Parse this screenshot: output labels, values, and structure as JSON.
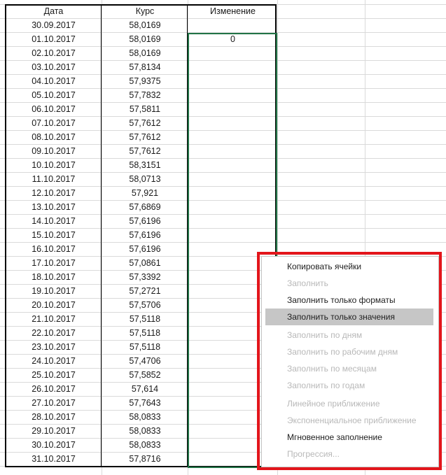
{
  "table": {
    "headers": [
      "Дата",
      "Курс",
      "Изменение"
    ],
    "rows": [
      [
        "30.09.2017",
        "58,0169",
        ""
      ],
      [
        "01.10.2017",
        "58,0169",
        "0"
      ],
      [
        "02.10.2017",
        "58,0169",
        ""
      ],
      [
        "03.10.2017",
        "57,8134",
        ""
      ],
      [
        "04.10.2017",
        "57,9375",
        ""
      ],
      [
        "05.10.2017",
        "57,7832",
        ""
      ],
      [
        "06.10.2017",
        "57,5811",
        ""
      ],
      [
        "07.10.2017",
        "57,7612",
        ""
      ],
      [
        "08.10.2017",
        "57,7612",
        ""
      ],
      [
        "09.10.2017",
        "57,7612",
        ""
      ],
      [
        "10.10.2017",
        "58,3151",
        ""
      ],
      [
        "11.10.2017",
        "58,0713",
        ""
      ],
      [
        "12.10.2017",
        "57,921",
        ""
      ],
      [
        "13.10.2017",
        "57,6869",
        ""
      ],
      [
        "14.10.2017",
        "57,6196",
        ""
      ],
      [
        "15.10.2017",
        "57,6196",
        ""
      ],
      [
        "16.10.2017",
        "57,6196",
        ""
      ],
      [
        "17.10.2017",
        "57,0861",
        ""
      ],
      [
        "18.10.2017",
        "57,3392",
        ""
      ],
      [
        "19.10.2017",
        "57,2721",
        ""
      ],
      [
        "20.10.2017",
        "57,5706",
        ""
      ],
      [
        "21.10.2017",
        "57,5118",
        ""
      ],
      [
        "22.10.2017",
        "57,5118",
        ""
      ],
      [
        "23.10.2017",
        "57,5118",
        ""
      ],
      [
        "24.10.2017",
        "57,4706",
        ""
      ],
      [
        "25.10.2017",
        "57,5852",
        ""
      ],
      [
        "26.10.2017",
        "57,614",
        ""
      ],
      [
        "27.10.2017",
        "57,7643",
        ""
      ],
      [
        "28.10.2017",
        "58,0833",
        ""
      ],
      [
        "29.10.2017",
        "58,0833",
        ""
      ],
      [
        "30.10.2017",
        "58,0833",
        ""
      ],
      [
        "31.10.2017",
        "57,8716",
        ""
      ]
    ]
  },
  "context_menu": {
    "items": [
      {
        "label": "Копировать ячейки",
        "enabled": true,
        "highlighted": false
      },
      {
        "label": "Заполнить",
        "enabled": false,
        "highlighted": false
      },
      {
        "label": "Заполнить только форматы",
        "enabled": true,
        "highlighted": false
      },
      {
        "label": "Заполнить только значения",
        "enabled": true,
        "highlighted": true
      },
      {
        "label": "Заполнить по дням",
        "enabled": false,
        "highlighted": false
      },
      {
        "label": "Заполнить по рабочим дням",
        "enabled": false,
        "highlighted": false
      },
      {
        "label": "Заполнить по месяцам",
        "enabled": false,
        "highlighted": false
      },
      {
        "label": "Заполнить по годам",
        "enabled": false,
        "highlighted": false
      },
      {
        "label": "Линейное приближение",
        "enabled": false,
        "highlighted": false
      },
      {
        "label": "Экспоненциальное приближение",
        "enabled": false,
        "highlighted": false
      },
      {
        "label": "Мгновенное заполнение",
        "enabled": true,
        "highlighted": false
      },
      {
        "label": "Прогрессия...",
        "enabled": false,
        "highlighted": false
      }
    ]
  },
  "colors": {
    "selection_border": "#217346",
    "annotation_box": "#e3151b",
    "menu_highlight": "#c6c6c6"
  }
}
